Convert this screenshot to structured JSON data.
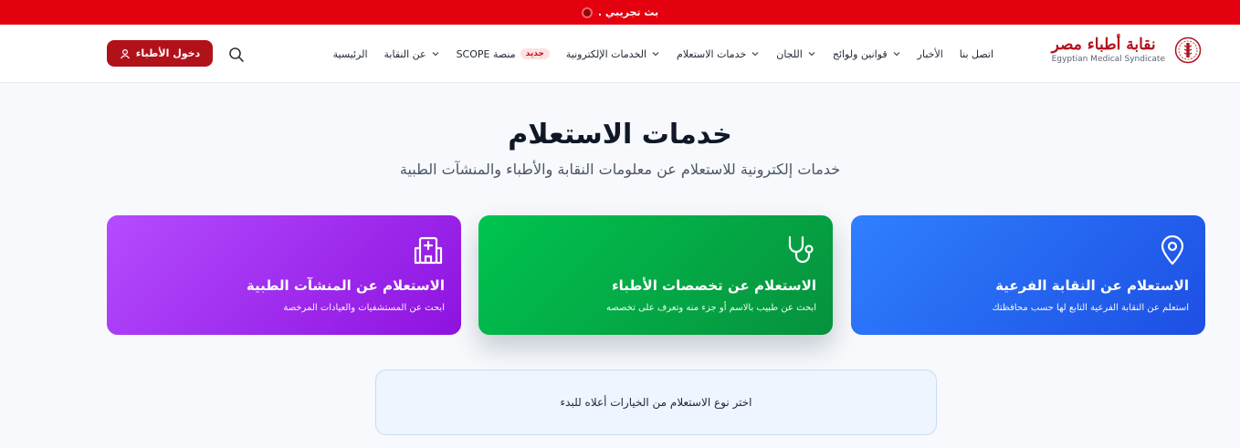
{
  "banner": {
    "text": "بث تجريبي ."
  },
  "logo": {
    "name_ar": "نقابة أطباء مصر",
    "name_en": "Egyptian Medical Syndicate"
  },
  "nav": {
    "items": [
      {
        "label": "الرئيسية",
        "dropdown": false
      },
      {
        "label": "عن النقابة",
        "dropdown": true
      },
      {
        "label": "منصة SCOPE",
        "dropdown": false,
        "badge": "جديد"
      },
      {
        "label": "الخدمات الإلكترونية",
        "dropdown": true
      },
      {
        "label": "خدمات الاستعلام",
        "dropdown": true
      },
      {
        "label": "اللجان",
        "dropdown": true
      },
      {
        "label": "قوانين ولوائح",
        "dropdown": true
      },
      {
        "label": "الأخبار",
        "dropdown": false
      },
      {
        "label": "اتصل بنا",
        "dropdown": false
      }
    ]
  },
  "header": {
    "login_label": "دخول الأطباء"
  },
  "hero": {
    "title": "خدمات الاستعلام",
    "subtitle": "خدمات إلكترونية للاستعلام عن معلومات النقابة والأطباء والمنشآت الطبية"
  },
  "cards": [
    {
      "title": "الاستعلام عن النقابة الفرعية",
      "desc": "استعلم عن النقابة الفرعية التابع لها حسب محافظتك",
      "icon": "map-pin-icon",
      "color": "#2563eb"
    },
    {
      "title": "الاستعلام عن تخصصات الأطباء",
      "desc": "ابحث عن طبيب بالاسم أو جزء منه وتعرف على تخصصه",
      "icon": "stethoscope-icon",
      "color": "#16a34a"
    },
    {
      "title": "الاستعلام عن المنشآت الطبية",
      "desc": "ابحث عن المستشفيات والعيادات المرخصة",
      "icon": "hospital-icon",
      "color": "#9333ea"
    }
  ],
  "hint": {
    "text": "اختر نوع الاستعلام من الخيارات أعلاه للبدء"
  },
  "colors": {
    "banner": "#e3000f",
    "brand": "#b1121a"
  }
}
